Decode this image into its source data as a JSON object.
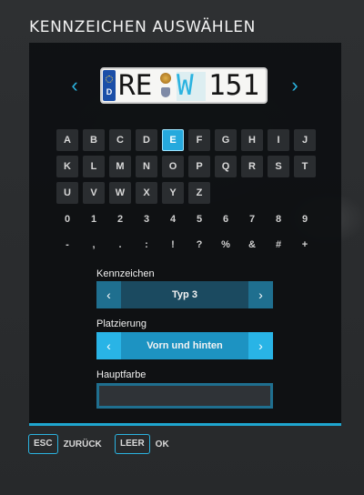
{
  "title": "KENNZEICHEN AUSWÄHLEN",
  "plate": {
    "country": "D",
    "city": "RE",
    "letters": "W",
    "numbers": "151",
    "left_arrow_icon": "chevron-left-icon",
    "right_arrow_icon": "chevron-right-icon"
  },
  "keyboard": {
    "rows": [
      [
        "A",
        "B",
        "C",
        "D",
        "E",
        "F",
        "G",
        "H",
        "I",
        "J"
      ],
      [
        "K",
        "L",
        "M",
        "N",
        "O",
        "P",
        "Q",
        "R",
        "S",
        "T"
      ],
      [
        "U",
        "V",
        "W",
        "X",
        "Y",
        "Z"
      ],
      [
        "0",
        "1",
        "2",
        "3",
        "4",
        "5",
        "6",
        "7",
        "8",
        "9"
      ],
      [
        "-",
        ",",
        ".",
        ":",
        "!",
        "?",
        "%",
        "&",
        "#",
        "+"
      ]
    ],
    "selected": "E"
  },
  "kennzeichen": {
    "label": "Kennzeichen",
    "value": "Typ 3",
    "prev": "‹",
    "next": "›"
  },
  "platzierung": {
    "label": "Platzierung",
    "value": "Vorn und hinten",
    "prev": "‹",
    "next": "›"
  },
  "hauptfarbe": {
    "label": "Hauptfarbe"
  },
  "hints": [
    {
      "key": "ESC",
      "action": "ZURÜCK"
    },
    {
      "key": "LEER",
      "action": "OK"
    }
  ],
  "colors": {
    "accent": "#2bb3e0",
    "panel": "#0e1012"
  }
}
